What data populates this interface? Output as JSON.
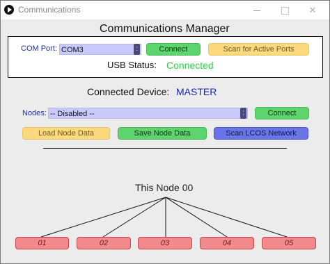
{
  "window": {
    "title": "Communications"
  },
  "manager": {
    "title": "Communications Manager"
  },
  "com_port": {
    "label": "COM Port:",
    "value": "COM3",
    "dropdown_glyph": ":"
  },
  "buttons": {
    "connect_port": "Connect",
    "scan_ports": "Scan for Active Ports",
    "connect_node": "Connect",
    "load_node": "Load Node Data",
    "save_node": "Save Node Data",
    "scan_network": "Scan LCOS Network"
  },
  "usb": {
    "label": "USB Status:",
    "value": "Connected",
    "color": "#2ecf4a"
  },
  "device": {
    "label": "Connected Device:",
    "value": "MASTER",
    "color": "#1a25b8"
  },
  "nodes": {
    "label": "Nodes:",
    "value": "-- Disabled --",
    "dropdown_glyph": ":"
  },
  "tree": {
    "root": "This Node 00",
    "children": [
      "01",
      "02",
      "03",
      "04",
      "05"
    ]
  },
  "colors": {
    "green_button": "#5ed46e",
    "yellow_button": "#fcd97c",
    "blue_button": "#6a74e6",
    "red_node": "#f18a8c",
    "field_bg": "#c9c9fb"
  }
}
